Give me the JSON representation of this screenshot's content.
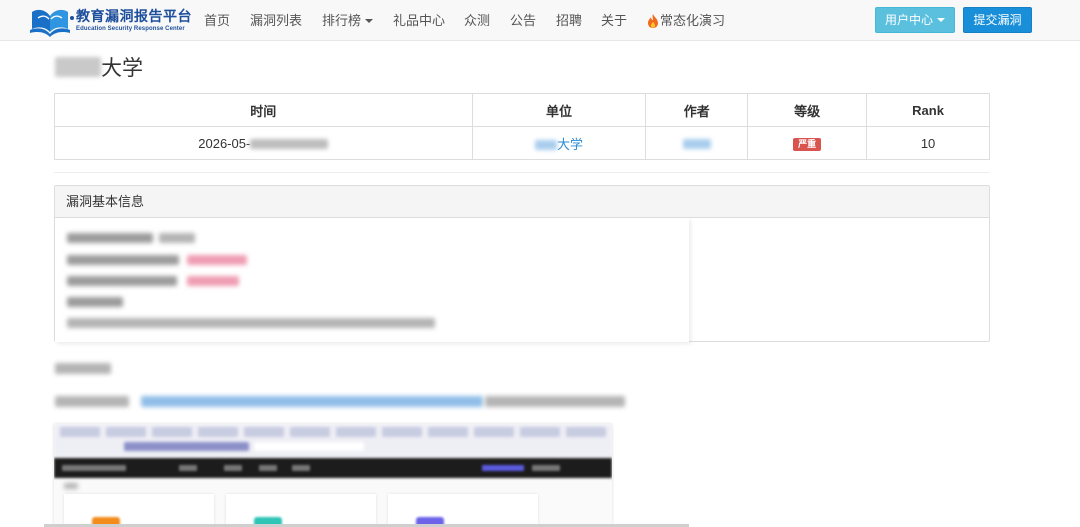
{
  "brand": {
    "name_cn": "教育漏洞报告平台",
    "name_en": "Education Security Response Center"
  },
  "nav": {
    "items": [
      {
        "label": "首页"
      },
      {
        "label": "漏洞列表"
      },
      {
        "label": "排行榜",
        "dropdown": true
      },
      {
        "label": "礼品中心"
      },
      {
        "label": "众测"
      },
      {
        "label": "公告"
      },
      {
        "label": "招聘"
      },
      {
        "label": "关于"
      },
      {
        "label": "常态化演习",
        "icon": "fire-icon"
      }
    ],
    "user_center": "用户中心",
    "submit": "提交漏洞"
  },
  "page": {
    "title_suffix": "大学"
  },
  "table": {
    "headers": [
      "时间",
      "单位",
      "作者",
      "等级",
      "Rank"
    ],
    "row": {
      "time_prefix": "2026-05-",
      "unit_suffix": "大学",
      "level": "严重",
      "rank": "10"
    }
  },
  "panel": {
    "heading": "漏洞基本信息"
  },
  "colors": {
    "brand": "#1e4f9c",
    "info_button": "#5bc0de",
    "primary_button": "#1a8fd9",
    "danger": "#d9534f",
    "link": "#2a8bd4"
  }
}
